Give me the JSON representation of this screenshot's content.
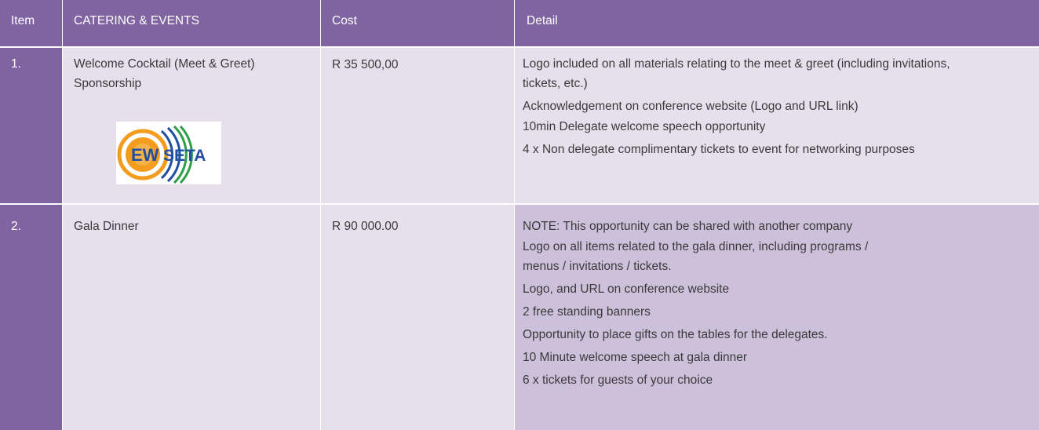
{
  "table": {
    "headers": {
      "item": "Item",
      "name": "CATERING & EVENTS",
      "cost": "Cost",
      "detail": "Detail"
    },
    "rows": [
      {
        "item": "1.",
        "name": "Welcome Cocktail (Meet & Greet) Sponsorship",
        "cost": "R 35 500,00",
        "logo": {
          "text_left": "EW",
          "text_right": "SETA",
          "colors": {
            "orange": "#f39c1e",
            "blue": "#1e4fa0",
            "green": "#2e9e48",
            "red_text": "#b01c2e"
          }
        },
        "details": [
          "Logo included on all materials relating to the meet & greet (including invitations, tickets, etc.)",
          "Acknowledgement on conference website (Logo and URL link)",
          "10min Delegate welcome speech opportunity",
          "4 x Non delegate complimentary tickets to event for networking purposes"
        ]
      },
      {
        "item": "2.",
        "name": "Gala Dinner",
        "cost": "R 90 000.00",
        "details": [
          "NOTE: This opportunity can be shared with another company",
          "Logo on all items related to the gala dinner, including programs / menus / invitations / tickets.",
          "Logo, and URL on conference website",
          "2 free standing banners",
          "Opportunity to place gifts on the tables for the delegates.",
          "10 Minute welcome speech at gala dinner",
          "6 x tickets for guests of your choice"
        ]
      }
    ]
  },
  "colors": {
    "header": "#8064a2",
    "row1": "#e6e0ec",
    "row2": "#ccc0da"
  }
}
